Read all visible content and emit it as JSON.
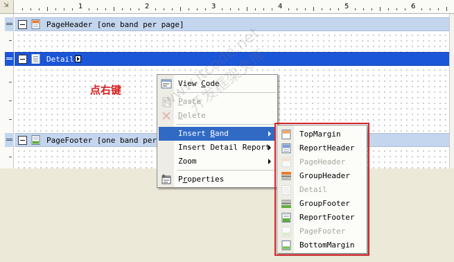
{
  "ruler": {
    "corner_glyph": "⇲",
    "marks": [
      "1",
      "2",
      "3",
      "4",
      "5",
      "6"
    ]
  },
  "bands": [
    {
      "id": "page-header",
      "title": "PageHeader [one band per page]",
      "selected": false
    },
    {
      "id": "detail",
      "title": "Detail",
      "selected": true
    },
    {
      "id": "page-footer",
      "title": "PageFooter [one band per page]",
      "selected": false
    }
  ],
  "annotation": {
    "text": "点右键",
    "color": "#d81c1c"
  },
  "context_menu": {
    "items": [
      {
        "label": "View Code",
        "mnemonic": "C",
        "icon": "view-code-icon",
        "disabled": false
      },
      {
        "label": "Paste",
        "mnemonic": "P",
        "icon": "paste-icon",
        "disabled": true
      },
      {
        "label": "Delete",
        "mnemonic": "D",
        "icon": "delete-icon",
        "disabled": true
      },
      {
        "label": "Insert Band",
        "mnemonic": "B",
        "disabled": false,
        "highlighted": true,
        "submenu": true
      },
      {
        "label": "Insert Detail Report",
        "disabled": false,
        "submenu": true
      },
      {
        "label": "Zoom",
        "disabled": false,
        "submenu": true
      },
      {
        "label": "Properties",
        "mnemonic": "r",
        "icon": "properties-icon",
        "disabled": false
      }
    ]
  },
  "insert_band_submenu": {
    "items": [
      {
        "label": "TopMargin",
        "icon": "top-margin-icon",
        "disabled": false
      },
      {
        "label": "ReportHeader",
        "icon": "report-header-icon",
        "disabled": false
      },
      {
        "label": "PageHeader",
        "icon": "page-header-icon",
        "disabled": true
      },
      {
        "label": "GroupHeader",
        "icon": "group-header-icon",
        "disabled": false
      },
      {
        "label": "Detail",
        "icon": "detail-icon",
        "disabled": true
      },
      {
        "label": "GroupFooter",
        "icon": "group-footer-icon",
        "disabled": false
      },
      {
        "label": "ReportFooter",
        "icon": "report-footer-icon",
        "disabled": false
      },
      {
        "label": "PageFooter",
        "icon": "page-footer-icon",
        "disabled": true
      },
      {
        "label": "BottomMargin",
        "icon": "bottom-margin-icon",
        "disabled": false
      }
    ],
    "highlight_color": "#d52128"
  },
  "watermark": {
    "line1": "www.itcode.net",
    "line2": "开发框架文库"
  },
  "colors": {
    "selection": "#316ac5",
    "band_header": "#c4d6ee",
    "band_selected": "#1b55d8"
  }
}
